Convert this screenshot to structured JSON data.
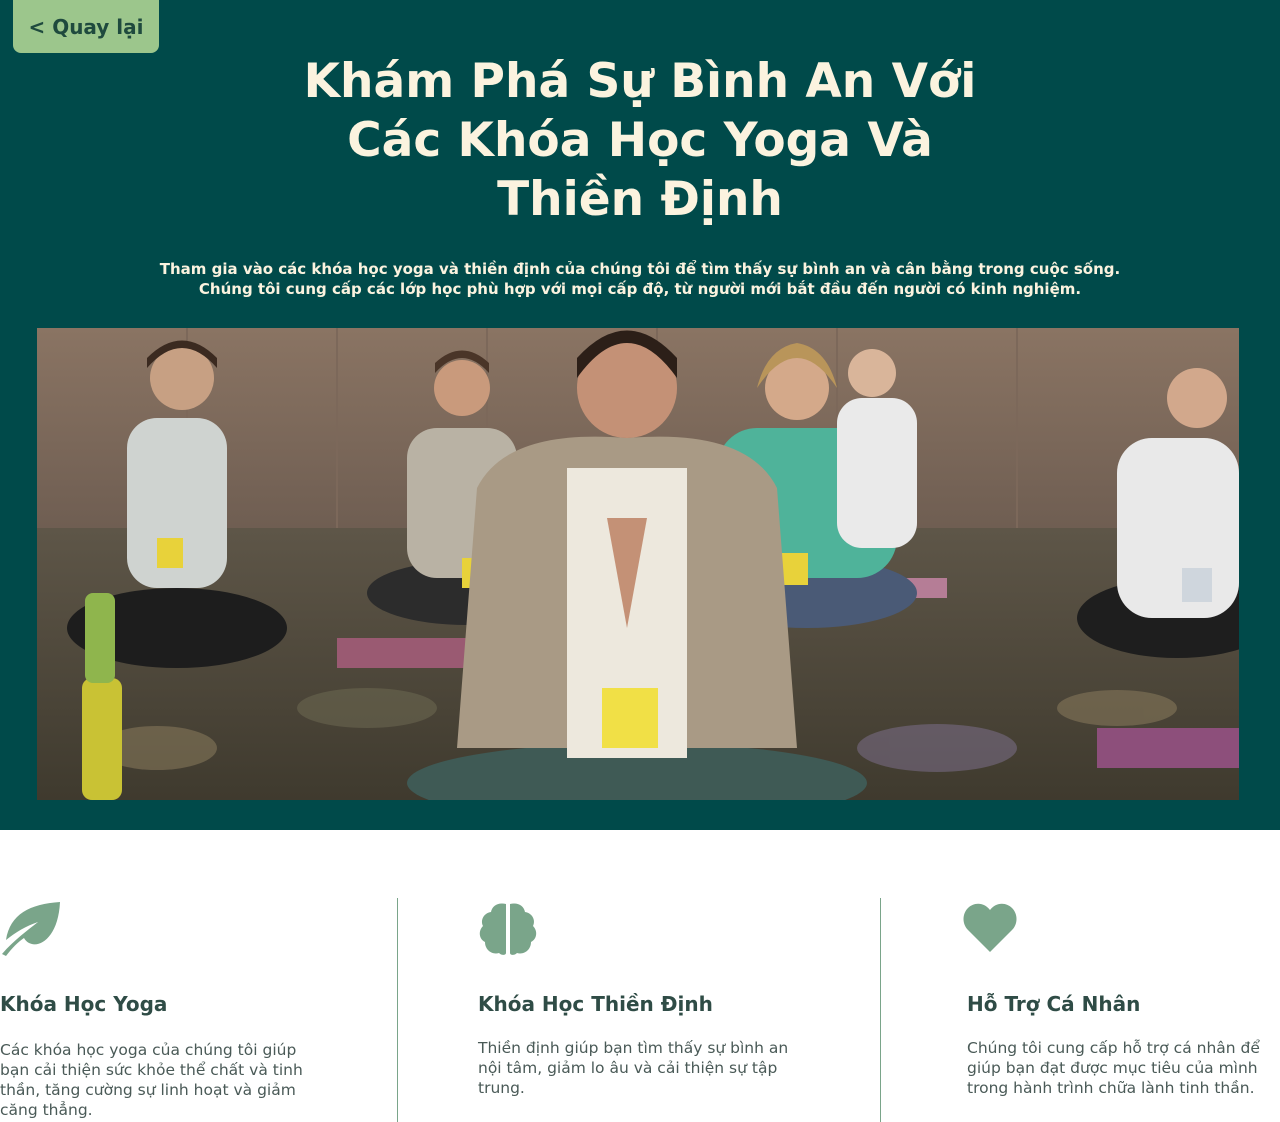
{
  "nav": {
    "back_label": "< Quay lại"
  },
  "hero": {
    "title_lines": [
      "Khám Phá Sự Bình An Với",
      "Các Khóa Học Yoga Và",
      "Thiền Định"
    ],
    "subtitle_lines": [
      "Tham gia vào các khóa học yoga và thiền định của chúng tôi để tìm thấy sự bình an và cân bằng trong cuộc sống.",
      "Chúng tôi cung cấp các lớp học phù hợp với mọi cấp độ, từ người mới bắt đầu đến người có kinh nghiệm."
    ]
  },
  "features": [
    {
      "icon": "leaf-icon",
      "title": "Khóa Học Yoga",
      "desc_lines": [
        "Các khóa học yoga của chúng tôi giúp",
        "bạn cải thiện sức khỏe thể chất và tinh",
        "thần, tăng cường sự linh hoạt và giảm",
        "căng thẳng."
      ]
    },
    {
      "icon": "brain-icon",
      "title": "Khóa Học Thiền Định",
      "desc_lines": [
        "Thiền định giúp bạn tìm thấy sự bình an",
        "nội tâm, giảm lo âu và cải thiện sự tập",
        "trung."
      ]
    },
    {
      "icon": "heart-icon",
      "title": "Hỗ Trợ Cá Nhân",
      "desc_lines": [
        "Chúng tôi cung cấp hỗ trợ cá nhân để",
        "giúp bạn đạt được mục tiêu của mình",
        "trong hành trình chữa lành tinh thần."
      ]
    }
  ],
  "colors": {
    "hero_bg": "#004a4a",
    "title_text": "#fbf3df",
    "back_button_bg": "#9cc68c",
    "icon_green": "#7aa58a",
    "divider": "#7aa58a"
  }
}
